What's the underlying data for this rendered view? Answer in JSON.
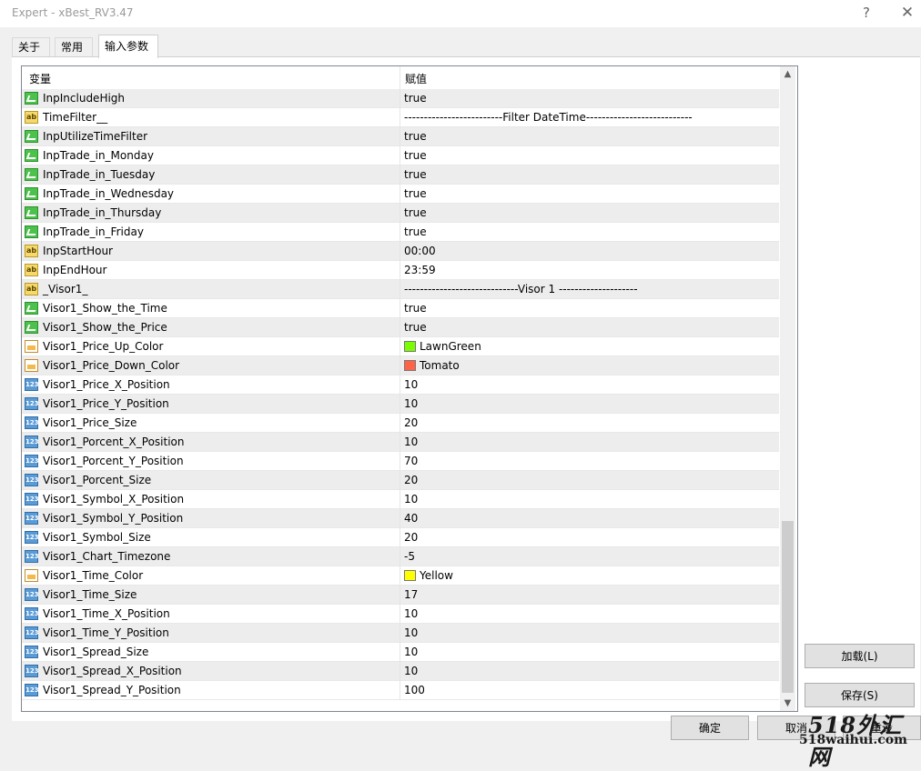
{
  "window": {
    "title": "Expert - xBest_RV3.47",
    "help": "?",
    "close": "✕"
  },
  "tabs": [
    {
      "label": "关于"
    },
    {
      "label": "常用"
    },
    {
      "label": "输入参数"
    }
  ],
  "grid": {
    "col_variable": "变量",
    "col_value": "赋值",
    "rows": [
      {
        "type": "bool",
        "name": "InpIncludeHigh",
        "value": "true"
      },
      {
        "type": "str",
        "name": "TimeFilter__",
        "value": "-------------------------Filter DateTime---------------------------"
      },
      {
        "type": "bool",
        "name": "InpUtilizeTimeFilter",
        "value": "true"
      },
      {
        "type": "bool",
        "name": "InpTrade_in_Monday",
        "value": "true"
      },
      {
        "type": "bool",
        "name": "InpTrade_in_Tuesday",
        "value": "true"
      },
      {
        "type": "bool",
        "name": "InpTrade_in_Wednesday",
        "value": "true"
      },
      {
        "type": "bool",
        "name": "InpTrade_in_Thursday",
        "value": "true"
      },
      {
        "type": "bool",
        "name": "InpTrade_in_Friday",
        "value": "true"
      },
      {
        "type": "str",
        "name": "InpStartHour",
        "value": "00:00"
      },
      {
        "type": "str",
        "name": "InpEndHour",
        "value": "23:59"
      },
      {
        "type": "str",
        "name": "_Visor1_",
        "value": "-----------------------------Visor 1 --------------------"
      },
      {
        "type": "bool",
        "name": "Visor1_Show_the_Time",
        "value": "true"
      },
      {
        "type": "bool",
        "name": "Visor1_Show_the_Price",
        "value": "true"
      },
      {
        "type": "color",
        "name": "Visor1_Price_Up_Color",
        "value": "LawnGreen",
        "swatch": "#7cfc00"
      },
      {
        "type": "color",
        "name": "Visor1_Price_Down_Color",
        "value": "Tomato",
        "swatch": "#ff6347"
      },
      {
        "type": "num",
        "name": "Visor1_Price_X_Position",
        "value": "10"
      },
      {
        "type": "num",
        "name": "Visor1_Price_Y_Position",
        "value": "10"
      },
      {
        "type": "num",
        "name": "Visor1_Price_Size",
        "value": "20"
      },
      {
        "type": "num",
        "name": "Visor1_Porcent_X_Position",
        "value": "10"
      },
      {
        "type": "num",
        "name": "Visor1_Porcent_Y_Position",
        "value": "70"
      },
      {
        "type": "num",
        "name": "Visor1_Porcent_Size",
        "value": "20"
      },
      {
        "type": "num",
        "name": "Visor1_Symbol_X_Position",
        "value": "10"
      },
      {
        "type": "num",
        "name": "Visor1_Symbol_Y_Position",
        "value": "40"
      },
      {
        "type": "num",
        "name": "Visor1_Symbol_Size",
        "value": "20"
      },
      {
        "type": "num",
        "name": "Visor1_Chart_Timezone",
        "value": "-5"
      },
      {
        "type": "color",
        "name": "Visor1_Time_Color",
        "value": "Yellow",
        "swatch": "#ffff00"
      },
      {
        "type": "num",
        "name": "Visor1_Time_Size",
        "value": "17"
      },
      {
        "type": "num",
        "name": "Visor1_Time_X_Position",
        "value": "10"
      },
      {
        "type": "num",
        "name": "Visor1_Time_Y_Position",
        "value": "10"
      },
      {
        "type": "num",
        "name": "Visor1_Spread_Size",
        "value": "10"
      },
      {
        "type": "num",
        "name": "Visor1_Spread_X_Position",
        "value": "10"
      },
      {
        "type": "num",
        "name": "Visor1_Spread_Y_Position",
        "value": "100"
      }
    ]
  },
  "icons": {
    "bool": "checkbox-icon",
    "str": "ab-string-icon",
    "num": "123-number-icon",
    "color": "color-palette-icon"
  },
  "icon_text": {
    "str": "ab",
    "num": "123"
  },
  "buttons": {
    "load": "加载(L)",
    "save": "保存(S)",
    "ok": "确定",
    "cancel": "取消",
    "reset": "重设"
  },
  "watermark": {
    "line1": "518外汇网",
    "line2": "518waihui.com"
  }
}
